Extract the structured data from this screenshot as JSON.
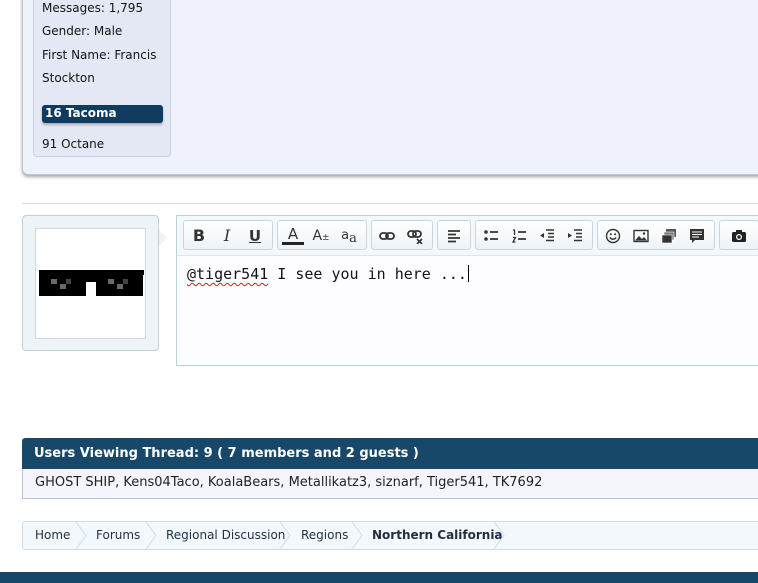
{
  "user_info": {
    "messages_label": "Messages:",
    "messages_value": "1,795",
    "gender_label": "Gender:",
    "gender_value": "Male",
    "first_name_label": "First Name:",
    "first_name_value": "Francis",
    "first_name_cont": "Stockton",
    "vehicle_badge": "16 Tacoma",
    "vehicle_secondary": "91 Octane"
  },
  "editor": {
    "mention": "@tiger541",
    "text": " I see you in here ...",
    "toolbar": {
      "bold": "B",
      "italic": "I",
      "underline": "U",
      "text_color": "A",
      "font_size": "A",
      "font_size_sup": "±",
      "font_family": "a",
      "font_family_sub": "a"
    }
  },
  "viewers": {
    "title": "Users Viewing Thread: 9 ( 7 members and 2 guests )",
    "members": "GHOST SHIP, Kens04Taco, KoalaBears, Metallikatz3, siznarf, Tiger541, TK7692"
  },
  "breadcrumb": {
    "items": [
      "Home",
      "Forums",
      "Regional Discussion",
      "Regions"
    ],
    "current": "Northern California"
  },
  "colors": {
    "header_blue": "#174769",
    "badge_blue": "#0f3c5e",
    "panel_bg": "#f0f2fb"
  }
}
